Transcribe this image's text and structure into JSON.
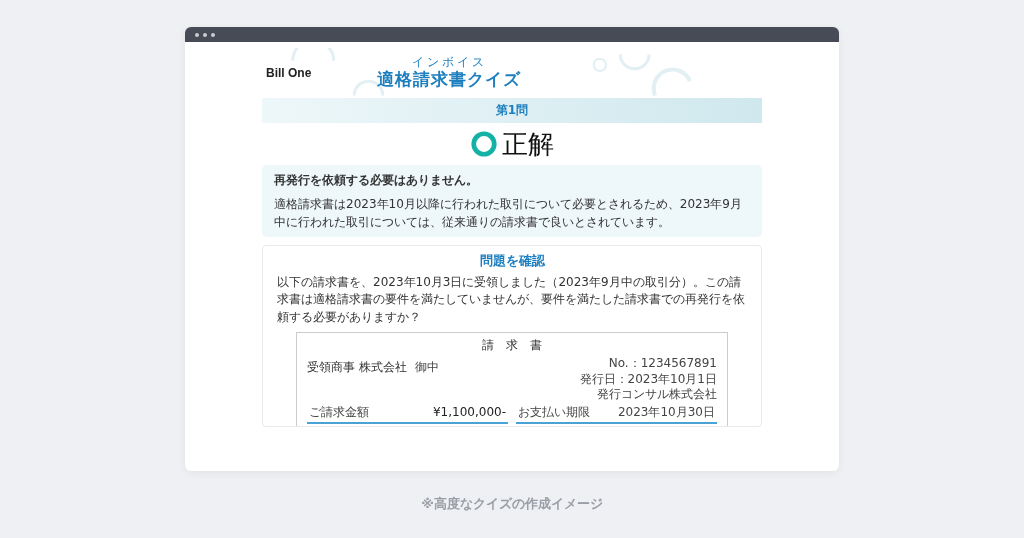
{
  "header": {
    "logo": "Bill One",
    "title": "適格請求書クイズ",
    "title_ruby": "インボイス"
  },
  "question_label": "第1問",
  "result": {
    "kind": "correct",
    "text": "正解"
  },
  "answer": {
    "headline": "再発行を依頼する必要はありません。",
    "body": "適格請求書は2023年10月以降に行われた取引について必要とされるため、2023年9月中に行われた取引については、従来通りの請求書で良いとされています。"
  },
  "review": {
    "title": "問題を確認",
    "question": "以下の請求書を、2023年10月3日に受領しました（2023年9月中の取引分）。この請求書は適格請求書の要件を満たしていませんが、要件を満たした請求書での再発行を依頼する必要がありますか？",
    "invoice": {
      "title": "請　求　書",
      "recipient": "受領商事 株式会社",
      "honorific": "御中",
      "number": "No.：1234567891",
      "issue_date": "発行日：2023年10月1日",
      "issuer": "発行コンサル株式会社",
      "amount_label": "ご請求金額",
      "amount": "¥1,100,000-",
      "due_label": "お支払い期限",
      "due": "2023年10月30日"
    }
  },
  "caption": "※高度なクイズの作成イメージ"
}
